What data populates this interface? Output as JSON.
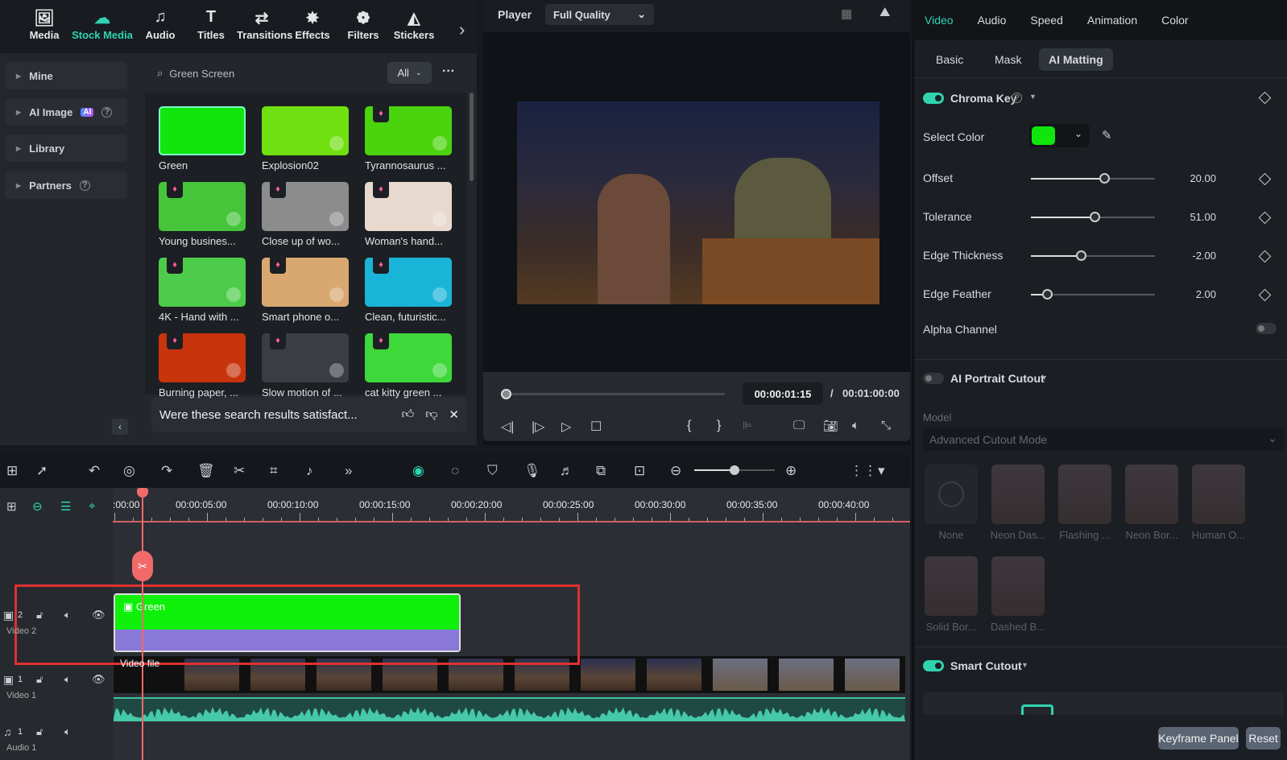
{
  "left_panel": {
    "nav": [
      {
        "label": "Media",
        "icon": "media-icon",
        "g": "🖼"
      },
      {
        "label": "Stock Media",
        "icon": "stock-media-icon",
        "g": "☁"
      },
      {
        "label": "Audio",
        "icon": "music-note-icon",
        "g": "♫"
      },
      {
        "label": "Titles",
        "icon": "titles-icon",
        "g": "T"
      },
      {
        "label": "Transitions",
        "icon": "transitions-icon",
        "g": "⇄"
      },
      {
        "label": "Effects",
        "icon": "effects-icon",
        "g": "✸"
      },
      {
        "label": "Filters",
        "icon": "filters-icon",
        "g": "❁"
      },
      {
        "label": "Stickers",
        "icon": "stickers-icon",
        "g": "◭"
      }
    ],
    "nav_more": "›",
    "sidebar": [
      {
        "label": "Mine"
      },
      {
        "label": "AI Image",
        "badge": "AI"
      },
      {
        "label": "Library"
      },
      {
        "label": "Partners"
      }
    ],
    "search": {
      "value": "Green Screen"
    },
    "filter": "All",
    "more": "···",
    "items": [
      {
        "label": "Green",
        "color": "#11e60c"
      },
      {
        "label": "Explosion02",
        "color": "#70e010"
      },
      {
        "label": "Tyrannosaurus ...",
        "color": "#4ad40e"
      },
      {
        "label": "Young busines...",
        "color": "#46c43a"
      },
      {
        "label": "Close up of wo...",
        "color": "#8c8c8c"
      },
      {
        "label": "Woman's hand...",
        "color": "#e8d9cf"
      },
      {
        "label": "4K - Hand with ...",
        "color": "#4ccc4a"
      },
      {
        "label": "Smart phone o...",
        "color": "#d8a870"
      },
      {
        "label": "Clean, futuristic...",
        "color": "#1ab4d8"
      },
      {
        "label": "Burning paper, ...",
        "color": "#c8340c"
      },
      {
        "label": "Slow motion of ...",
        "color": "#3a3e44"
      },
      {
        "label": "cat kitty green ...",
        "color": "#3ed83a"
      }
    ],
    "feedback": "Were these search results satisfact...",
    "collapse": "‹"
  },
  "player": {
    "label": "Player",
    "quality": "Full Quality",
    "progress": 0.02,
    "current_time": "00:00:01:15",
    "separator": "/",
    "total_time": "00:01:00:00",
    "mark_in": "{",
    "mark_out": "}"
  },
  "right_panel": {
    "tabs": [
      "Video",
      "Audio",
      "Speed",
      "Animation",
      "Color"
    ],
    "subtabs": [
      "Basic",
      "Mask",
      "AI Matting"
    ],
    "chroma": {
      "title": "Chroma Key",
      "enabled": true,
      "select_color_label": "Select Color",
      "color": "#11e60c",
      "sliders": [
        {
          "label": "Offset",
          "value": "20.00",
          "pos": 0.59
        },
        {
          "label": "Tolerance",
          "value": "51.00",
          "pos": 0.51
        },
        {
          "label": "Edge Thickness",
          "value": "-2.00",
          "pos": 0.4
        },
        {
          "label": "Edge Feather",
          "value": "2.00",
          "pos": 0.13
        }
      ],
      "alpha_label": "Alpha Channel"
    },
    "portrait": {
      "title": "AI Portrait Cutout",
      "model_label": "Model",
      "model": "Advanced Cutout Mode",
      "presets": [
        "None",
        "Neon Das...",
        "Flashing ...",
        "Neon Bor...",
        "Human O...",
        "Solid Bor...",
        "Dashed B..."
      ]
    },
    "smart": {
      "title": "Smart Cutout"
    },
    "keyframe": "Keyframe Panel",
    "reset": "Reset"
  },
  "timeline": {
    "ticks": [
      ":00:00",
      "00:00:05:00",
      "00:00:10:00",
      "00:00:15:00",
      "00:00:20:00",
      "00:00:25:00",
      "00:00:30:00",
      "00:00:35:00",
      "00:00:40:00"
    ],
    "tracks": [
      {
        "num": "2",
        "name": "Video 2"
      },
      {
        "num": "1",
        "name": "Video 1"
      },
      {
        "num": "1",
        "name": "Audio 1"
      }
    ],
    "clip_green": "Green",
    "clip_video": "Video file"
  }
}
